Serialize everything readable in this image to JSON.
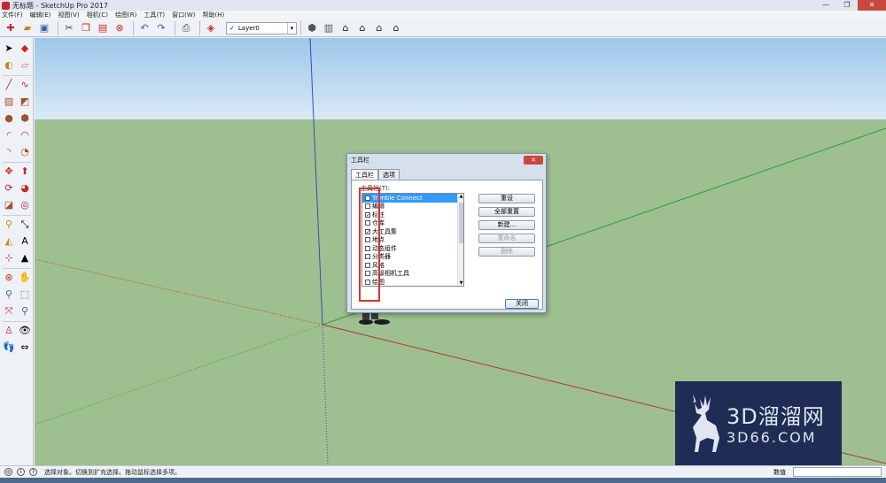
{
  "window": {
    "title": "无标题 - SketchUp Pro 2017",
    "controls": [
      "—",
      "❐",
      "✕"
    ]
  },
  "menu": [
    "文件(F)",
    "编辑(E)",
    "视图(V)",
    "相机(C)",
    "绘图(R)",
    "工具(T)",
    "窗口(W)",
    "帮助(H)"
  ],
  "toolbar": {
    "layer_value": "Layer0",
    "layer_check": "✓",
    "select_arrow": "▾"
  },
  "dialog": {
    "title": "工具栏",
    "close": "✕",
    "tabs": [
      "工具栏",
      "选项"
    ],
    "list_label": "工具栏(T):",
    "items": [
      {
        "label": "Trimble Connect",
        "checked": false,
        "selected": true
      },
      {
        "label": "编辑",
        "checked": false,
        "selected": false
      },
      {
        "label": "标注",
        "checked": true,
        "selected": false
      },
      {
        "label": "仓库",
        "checked": false,
        "selected": false
      },
      {
        "label": "大工具集",
        "checked": true,
        "selected": false
      },
      {
        "label": "地点",
        "checked": false,
        "selected": false
      },
      {
        "label": "动态组件",
        "checked": false,
        "selected": false
      },
      {
        "label": "分类器",
        "checked": false,
        "selected": false
      },
      {
        "label": "风格",
        "checked": false,
        "selected": false
      },
      {
        "label": "高级相机工具",
        "checked": false,
        "selected": false
      },
      {
        "label": "绘图",
        "checked": false,
        "selected": false
      }
    ],
    "buttons": {
      "reset": "重设",
      "reset_all": "全部重置",
      "new": "新建...",
      "rename": "重命名",
      "delete": "删除",
      "close": "关闭"
    },
    "scroll_up": "▲",
    "scroll_down": "▼"
  },
  "status": {
    "message": "选择对象。切换到扩充选择。拖动鼠标选择多项。",
    "measurements_label": "数值",
    "info_icon": "i",
    "geo_icon": "◎"
  },
  "watermark": {
    "text": "3D溜溜网",
    "sub": "3D66.COM"
  },
  "colors": {
    "sky_top": "#9dc7ea",
    "ground": "#9ebf8f",
    "red_axis": "#b03a2e",
    "green_axis": "#2e9e3a",
    "blue_axis": "#2f4fb0",
    "selection": "#3399ff",
    "annotation": "#d9342b"
  }
}
